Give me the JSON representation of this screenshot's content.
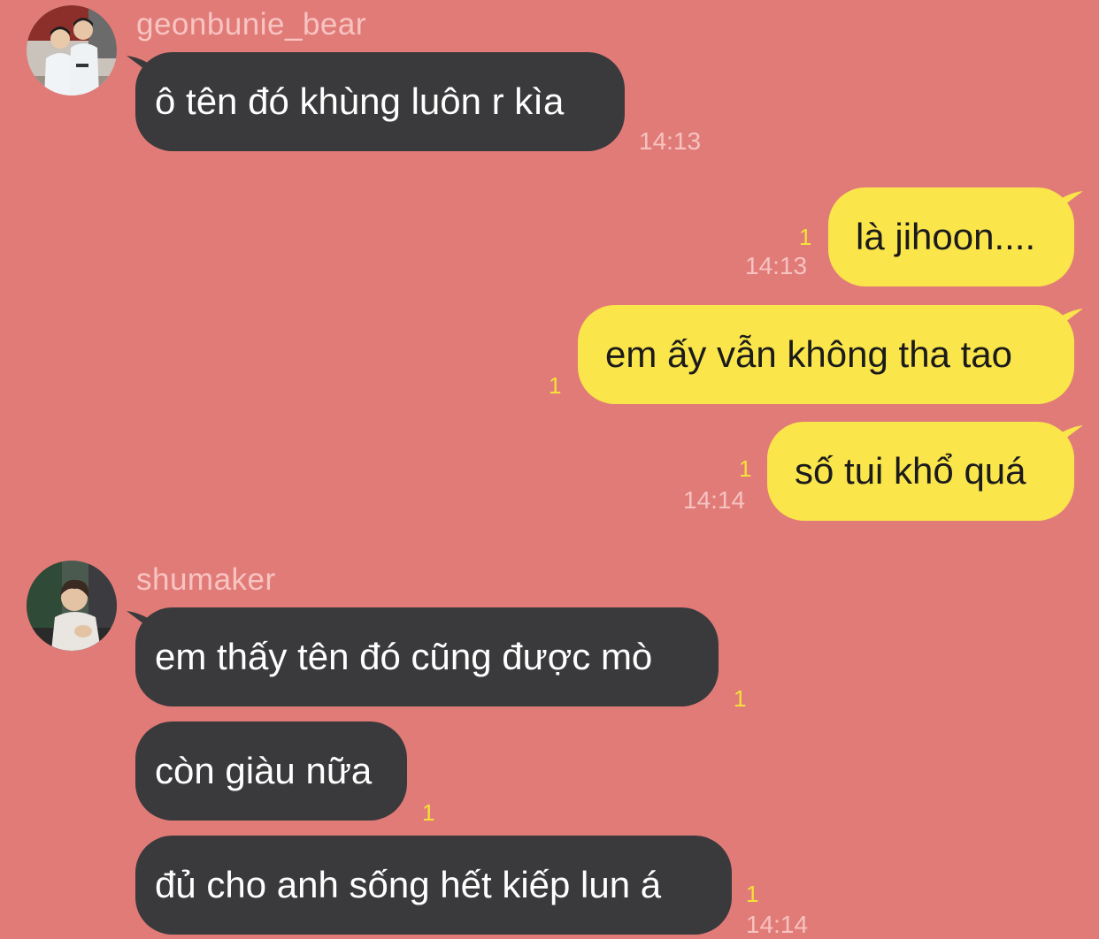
{
  "colors": {
    "background": "#e17b78",
    "incoming_bubble": "#3a3a3c",
    "outgoing_bubble": "#fae54b",
    "unread_count": "#f5e13a",
    "meta_text": "#f6c3c0"
  },
  "messages": {
    "m1": {
      "sender": "geonbunie_bear",
      "text": "ô tên đó khùng luôn r kìa",
      "time": "14:13"
    },
    "m2": {
      "text": "là jihoon....",
      "unread": "1",
      "time": "14:13"
    },
    "m3": {
      "text": "em ấy vẫn không tha tao",
      "unread": "1"
    },
    "m4": {
      "text": "số tui khổ quá",
      "unread": "1",
      "time": "14:14"
    },
    "m5": {
      "sender": "shumaker",
      "text": "em thấy tên đó cũng được mò",
      "unread": "1"
    },
    "m6": {
      "text": "còn giàu nữa",
      "unread": "1"
    },
    "m7": {
      "text": "đủ cho anh sống hết kiếp lun á",
      "unread": "1",
      "time": "14:14"
    }
  }
}
